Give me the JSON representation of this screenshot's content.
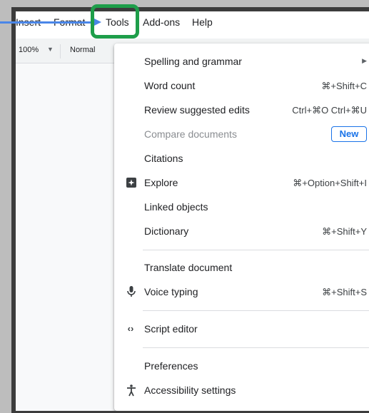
{
  "menubar": {
    "items": [
      "Insert",
      "Format",
      "Tools",
      "Add-ons",
      "Help"
    ]
  },
  "toolbar": {
    "zoom": "100%",
    "paragraph_style": "Normal"
  },
  "tools_menu": {
    "items": {
      "spelling": {
        "label": "Spelling and grammar",
        "submenu": true
      },
      "word_count": {
        "label": "Word count",
        "shortcut": "⌘+Shift+C"
      },
      "review_edits": {
        "label": "Review suggested edits",
        "shortcut": "Ctrl+⌘O Ctrl+⌘U"
      },
      "compare": {
        "label": "Compare documents",
        "badge": "New",
        "disabled": true
      },
      "citations": {
        "label": "Citations"
      },
      "explore": {
        "label": "Explore",
        "shortcut": "⌘+Option+Shift+I",
        "icon": "explore-icon"
      },
      "linked_objects": {
        "label": "Linked objects"
      },
      "dictionary": {
        "label": "Dictionary",
        "shortcut": "⌘+Shift+Y"
      },
      "translate": {
        "label": "Translate document"
      },
      "voice_typing": {
        "label": "Voice typing",
        "shortcut": "⌘+Shift+S",
        "icon": "microphone-icon"
      },
      "script_editor": {
        "label": "Script editor",
        "icon": "code-icon"
      },
      "preferences": {
        "label": "Preferences"
      },
      "accessibility": {
        "label": "Accessibility settings",
        "icon": "accessibility-icon"
      }
    }
  },
  "colors": {
    "highlight": "#1e9e4a",
    "pointer": "#4a86e8",
    "badge": "#1a73e8"
  }
}
